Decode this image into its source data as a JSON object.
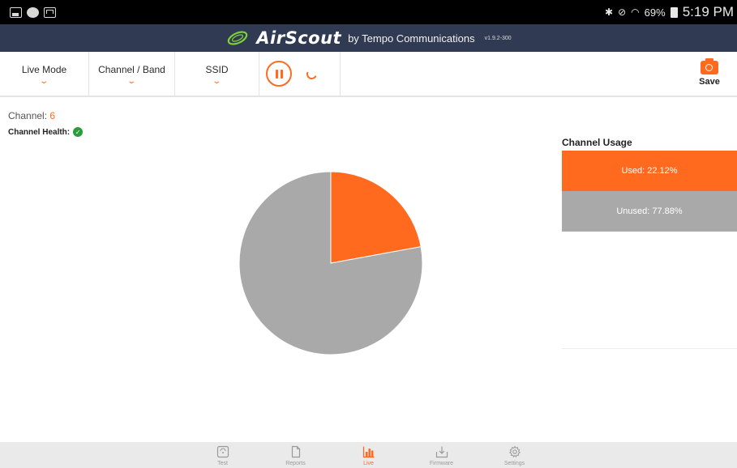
{
  "status_bar": {
    "battery": "69%",
    "time": "5:19 PM"
  },
  "title_bar": {
    "brand": "AirScout",
    "byline": "by Tempo Communications",
    "version": "v1.9.2-300"
  },
  "toolbar": {
    "live_mode_label": "Live Mode",
    "channel_band_label": "Channel / Band",
    "ssid_label": "SSID",
    "save_label": "Save"
  },
  "main": {
    "channel_label": "Channel:",
    "channel_value": "6",
    "health_label": "Channel Health:"
  },
  "usage": {
    "title": "Channel Usage",
    "used_label": "Used: 22.12%",
    "unused_label": "Unused: 77.88%"
  },
  "chart_data": {
    "type": "pie",
    "title": "",
    "categories": [
      "Used",
      "Unused"
    ],
    "values": [
      22.12,
      77.88
    ],
    "colors": [
      "#ff6a1f",
      "#a9a9a9"
    ],
    "legend": "right"
  },
  "bottom_nav": {
    "items": [
      {
        "label": "Test",
        "icon": "test-icon",
        "active": false
      },
      {
        "label": "Reports",
        "icon": "document-icon",
        "active": false
      },
      {
        "label": "Live",
        "icon": "bar-chart-icon",
        "active": true
      },
      {
        "label": "Firmware",
        "icon": "download-icon",
        "active": false
      },
      {
        "label": "Settings",
        "icon": "gear-icon",
        "active": false
      }
    ]
  },
  "colors": {
    "accent": "#ff6a1f",
    "title_bar": "#303a52",
    "unused_gray": "#a9a9a9",
    "health_ok": "#2a9d3a"
  }
}
